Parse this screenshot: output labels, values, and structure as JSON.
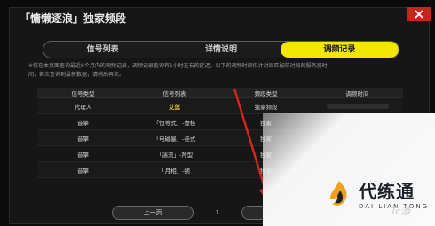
{
  "window": {
    "title": "「慵懒逐浪」独家频段"
  },
  "tabs": [
    {
      "label": "信号列表",
      "active": false
    },
    {
      "label": "详情说明",
      "active": false
    },
    {
      "label": "调频记录",
      "active": true
    }
  ],
  "notice": {
    "line1": "※仅在本页面查询最近6个月内的调频记录，调频记录查询有1小时左右的延迟，以下的调频时间仅计对局匹配前对局的服务器时",
    "line2": "间，若未查询到最新数据，请稍后再来。"
  },
  "table": {
    "headers": [
      "信号类型",
      "信号列表",
      "频段类型",
      "调频时间"
    ],
    "rows": [
      {
        "type": "代理人",
        "list": "艾莲",
        "band": "独家频段",
        "time": "",
        "highlight": true
      },
      {
        "type": "音擎",
        "list": "「恒等式」-壹核",
        "band": "独家",
        "time": "",
        "highlight": false
      },
      {
        "type": "音擎",
        "list": "「电磁暴」-叁式",
        "band": "独家",
        "time": "",
        "highlight": false
      },
      {
        "type": "音擎",
        "list": "「湍流」-斧型",
        "band": "独家",
        "time": "",
        "highlight": false
      },
      {
        "type": "音擎",
        "list": "「月相」-朔",
        "band": "独家",
        "time": "",
        "highlight": false
      }
    ]
  },
  "pager": {
    "prev_label": "上一页",
    "current_page": "1"
  },
  "watermark": {
    "brand": "代练通",
    "pinyin": "DAI LIAN TONG",
    "extra": "Tc游"
  },
  "colors": {
    "accent": "#f3e600",
    "close": "#c2261c",
    "arrow": "#d8261b"
  },
  "icons": {
    "close": "close-icon",
    "logo": "flame-logo-icon"
  }
}
